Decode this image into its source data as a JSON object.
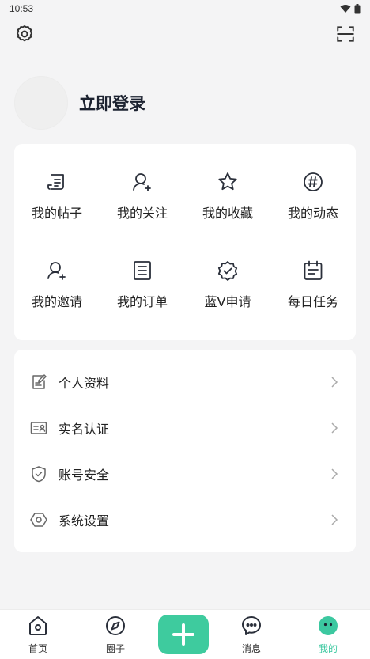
{
  "status_bar": {
    "time": "10:53"
  },
  "profile": {
    "login_label": "立即登录"
  },
  "grid": [
    {
      "label": "我的帖子",
      "icon": "post-icon"
    },
    {
      "label": "我的关注",
      "icon": "follow-user-icon"
    },
    {
      "label": "我的收藏",
      "icon": "star-icon"
    },
    {
      "label": "我的动态",
      "icon": "hashtag-icon"
    },
    {
      "label": "我的邀请",
      "icon": "invite-user-icon"
    },
    {
      "label": "我的订单",
      "icon": "order-icon"
    },
    {
      "label": "蓝V申请",
      "icon": "verified-badge-icon"
    },
    {
      "label": "每日任务",
      "icon": "calendar-icon"
    }
  ],
  "list": [
    {
      "label": "个人资料",
      "icon": "edit-profile-icon"
    },
    {
      "label": "实名认证",
      "icon": "id-card-icon"
    },
    {
      "label": "账号安全",
      "icon": "shield-icon"
    },
    {
      "label": "系统设置",
      "icon": "settings-hex-icon"
    }
  ],
  "tabbar": {
    "home": "首页",
    "circle": "圈子",
    "messages": "消息",
    "mine": "我的"
  },
  "colors": {
    "accent": "#3ecb9e",
    "active_tab": "#3cc8a0"
  }
}
